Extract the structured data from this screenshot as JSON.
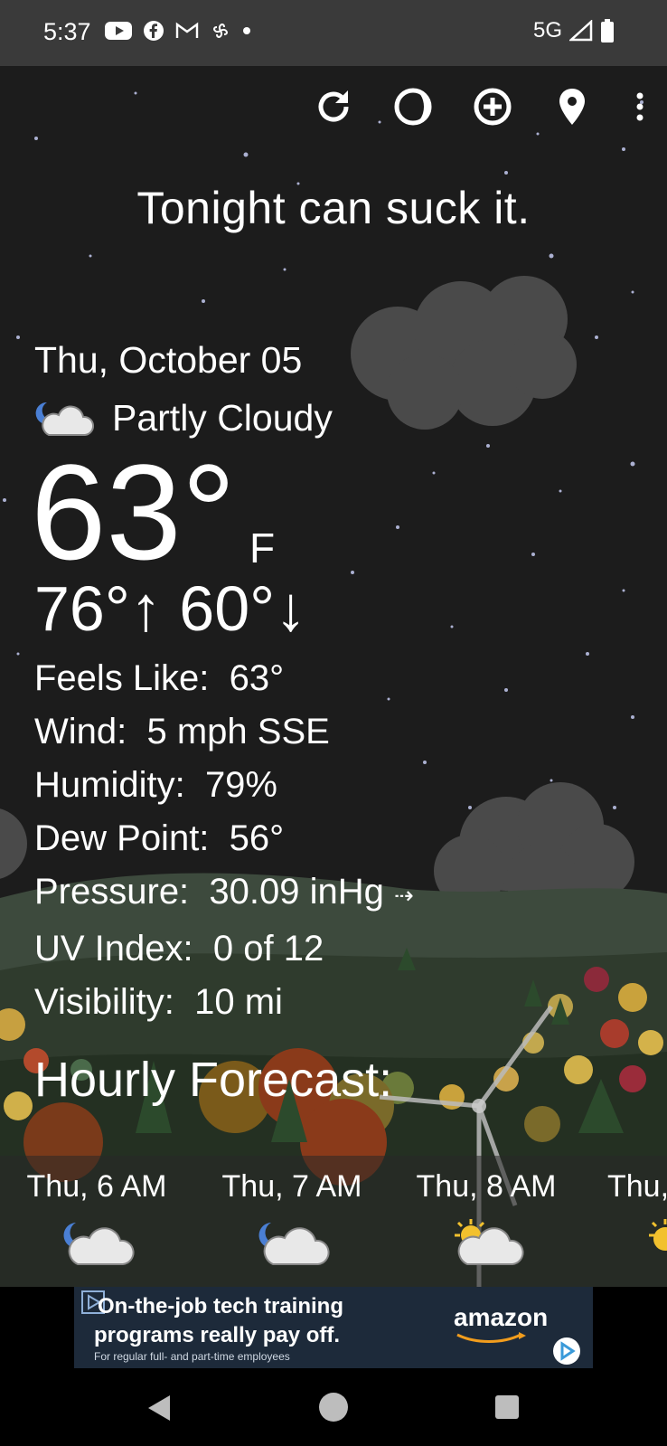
{
  "status_bar": {
    "time": "5:37",
    "network": "5G"
  },
  "headline": "Tonight can suck it.",
  "current": {
    "date": "Thu, October 05",
    "condition": "Partly Cloudy",
    "temp": "63°",
    "unit": "F",
    "hi_lo": "76°↑ 60°↓"
  },
  "details": [
    {
      "label": "Feels Like:",
      "value": "63°"
    },
    {
      "label": "Wind:",
      "value": "5 mph SSE"
    },
    {
      "label": "Humidity:",
      "value": "79%"
    },
    {
      "label": "Dew Point:",
      "value": "56°"
    },
    {
      "label": "Pressure:",
      "value": "30.09 inHg"
    },
    {
      "label": "UV Index:",
      "value": "0 of 12"
    },
    {
      "label": "Visibility:",
      "value": "10 mi"
    }
  ],
  "pressure_trend": "⇢",
  "hourly": {
    "title": "Hourly Forecast:",
    "items": [
      {
        "time": "Thu, 6 AM",
        "icon": "partly-cloudy-night-icon"
      },
      {
        "time": "Thu, 7 AM",
        "icon": "partly-cloudy-night-icon"
      },
      {
        "time": "Thu, 8 AM",
        "icon": "partly-sunny-icon"
      },
      {
        "time": "Thu,",
        "icon": "sun-icon"
      }
    ]
  },
  "ad": {
    "line1": "On-the-job tech training",
    "line2": "programs really pay off.",
    "line3": "For regular full- and part-time employees",
    "brand": "amazon"
  },
  "colors": {
    "status_bar": "#3a3a3a",
    "background": "#1c1c1c",
    "ad_bg": "#1d2a3a"
  }
}
